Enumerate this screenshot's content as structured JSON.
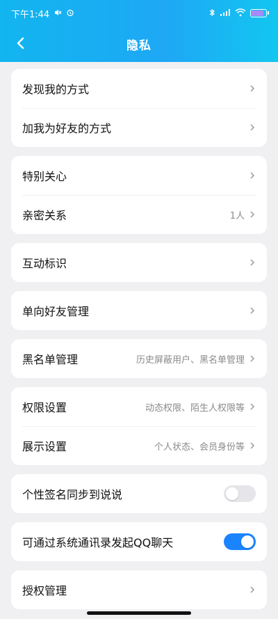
{
  "status_bar": {
    "time": "下午1:44",
    "battery_level": "88"
  },
  "header": {
    "title": "隐私"
  },
  "sections": [
    {
      "rows": [
        {
          "label": "发现我的方式",
          "value": ""
        },
        {
          "label": "加我为好友的方式",
          "value": ""
        }
      ]
    },
    {
      "rows": [
        {
          "label": "特别关心",
          "value": ""
        },
        {
          "label": "亲密关系",
          "value": "1人"
        }
      ]
    },
    {
      "rows": [
        {
          "label": "互动标识",
          "value": ""
        }
      ]
    },
    {
      "rows": [
        {
          "label": "单向好友管理",
          "value": ""
        }
      ]
    },
    {
      "rows": [
        {
          "label": "黑名单管理",
          "value": "历史屏蔽用户、黑名单管理"
        }
      ]
    },
    {
      "rows": [
        {
          "label": "权限设置",
          "value": "动态权限、陌生人权限等"
        },
        {
          "label": "展示设置",
          "value": "个人状态、会员身份等"
        }
      ]
    },
    {
      "rows": [
        {
          "label": "个性签名同步到说说",
          "toggle": "off"
        }
      ]
    },
    {
      "rows": [
        {
          "label": "可通过系统通讯录发起QQ聊天",
          "toggle": "on"
        }
      ]
    },
    {
      "rows": [
        {
          "label": "授权管理",
          "value": ""
        }
      ]
    }
  ],
  "colors": {
    "header_gradient_start": "#12b5ef",
    "toggle_on": "#1a84ff",
    "toggle_off": "#e6e6ea"
  }
}
